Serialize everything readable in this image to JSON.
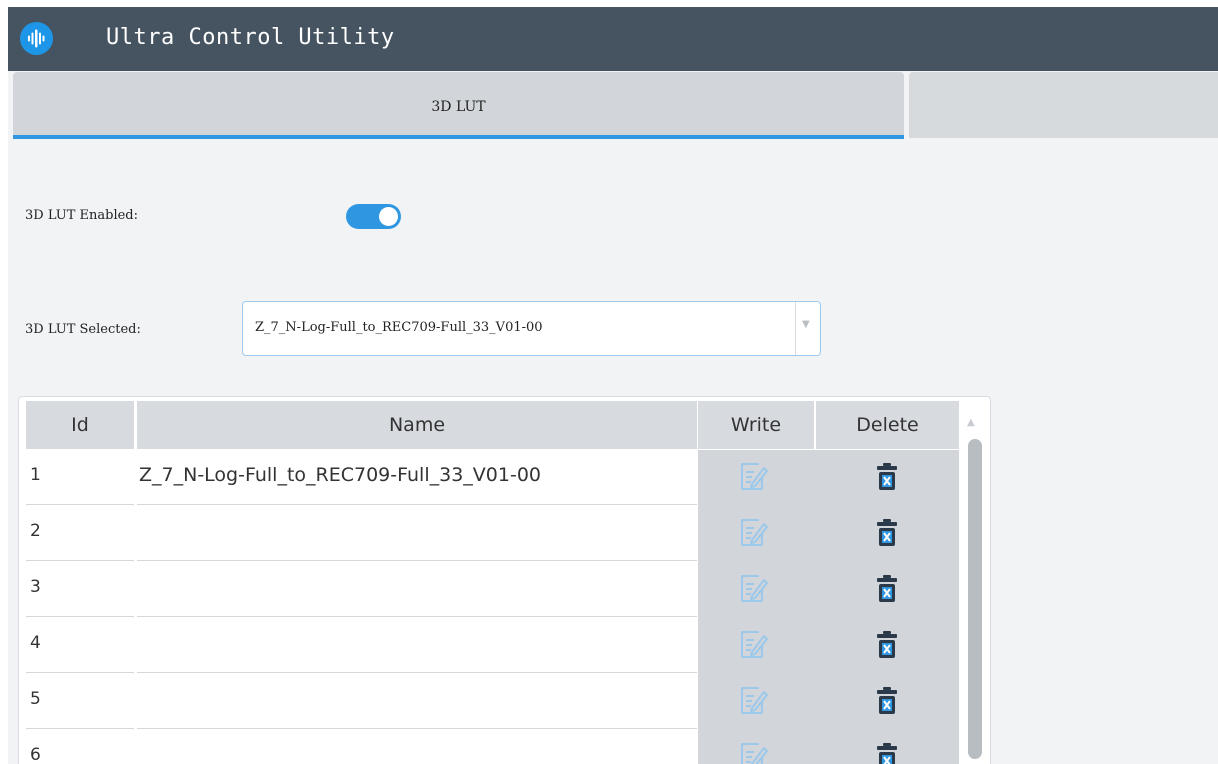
{
  "app": {
    "title": "Ultra Control Utility",
    "logo_icon": "sound-wave-icon"
  },
  "tabs": [
    {
      "label": "3D LUT",
      "active": true
    },
    {
      "label": "",
      "active": false
    }
  ],
  "lut_enabled": {
    "label": "3D LUT Enabled:",
    "value": true
  },
  "lut_selected": {
    "label": "3D LUT Selected:",
    "value": "Z_7_N-Log-Full_to_REC709-Full_33_V01-00"
  },
  "table": {
    "columns": [
      "Id",
      "Name",
      "Write",
      "Delete"
    ],
    "rows": [
      {
        "id": "1",
        "name": "Z_7_N-Log-Full_to_REC709-Full_33_V01-00"
      },
      {
        "id": "2",
        "name": ""
      },
      {
        "id": "3",
        "name": ""
      },
      {
        "id": "4",
        "name": ""
      },
      {
        "id": "5",
        "name": ""
      },
      {
        "id": "6",
        "name": ""
      }
    ],
    "write_icon": "edit-document-icon",
    "delete_icon": "trash-icon"
  },
  "colors": {
    "title_bar": "#465462",
    "accent": "#2f97e1",
    "column_header": "#d7dbdf",
    "action_cells": "#d2d6da"
  }
}
